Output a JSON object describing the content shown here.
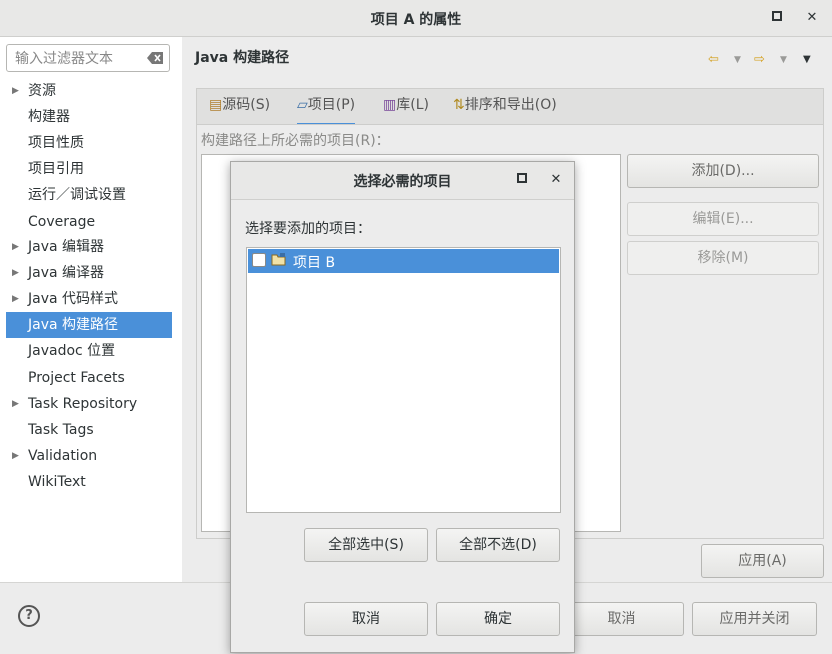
{
  "window": {
    "title": "项目 A 的属性",
    "maximize_icon": "maximize-icon",
    "close_icon": "close-icon"
  },
  "filter": {
    "placeholder": "输入过滤器文本",
    "clear_icon": "clear-text-icon"
  },
  "tree": {
    "items": [
      {
        "label": "资源",
        "expandable": true
      },
      {
        "label": "构建器",
        "expandable": false
      },
      {
        "label": "项目性质",
        "expandable": false
      },
      {
        "label": "项目引用",
        "expandable": false
      },
      {
        "label": "运行／调试设置",
        "expandable": false
      },
      {
        "label": "Coverage",
        "expandable": false
      },
      {
        "label": "Java 编辑器",
        "expandable": true
      },
      {
        "label": "Java 编译器",
        "expandable": true
      },
      {
        "label": "Java 代码样式",
        "expandable": true
      },
      {
        "label": "Java 构建路径",
        "expandable": false,
        "selected": true
      },
      {
        "label": "Javadoc 位置",
        "expandable": false
      },
      {
        "label": "Project Facets",
        "expandable": false
      },
      {
        "label": "Task Repository",
        "expandable": true
      },
      {
        "label": "Task Tags",
        "expandable": false
      },
      {
        "label": "Validation",
        "expandable": true
      },
      {
        "label": "WikiText",
        "expandable": false
      }
    ]
  },
  "page": {
    "heading": "Java 构建路径"
  },
  "tabs": [
    {
      "label": "源码(S)",
      "icon": "source-folder-icon"
    },
    {
      "label": "项目(P)",
      "icon": "project-folder-icon",
      "active": true
    },
    {
      "label": "库(L)",
      "icon": "library-icon"
    },
    {
      "label": "排序和导出(O)",
      "icon": "order-export-icon"
    }
  ],
  "projects_tab": {
    "list_label": "构建路径上所必需的项目(R)：",
    "add": "添加(D)...",
    "edit": "编辑(E)...",
    "remove": "移除(M)"
  },
  "apply": "应用(A)",
  "bottom": {
    "cancel": "取消",
    "apply_close": "应用并关闭"
  },
  "dialog": {
    "title": "选择必需的项目",
    "prompt": "选择要添加的项目：",
    "items": [
      {
        "label": "项目 B",
        "checked": false
      }
    ],
    "select_all": "全部选中(S)",
    "deselect_all": "全部不选(D)",
    "cancel": "取消",
    "ok": "确定"
  },
  "colors": {
    "selection": "#4a90d9",
    "background": "#ececec",
    "active_tab_underline": "#4a90d9"
  }
}
